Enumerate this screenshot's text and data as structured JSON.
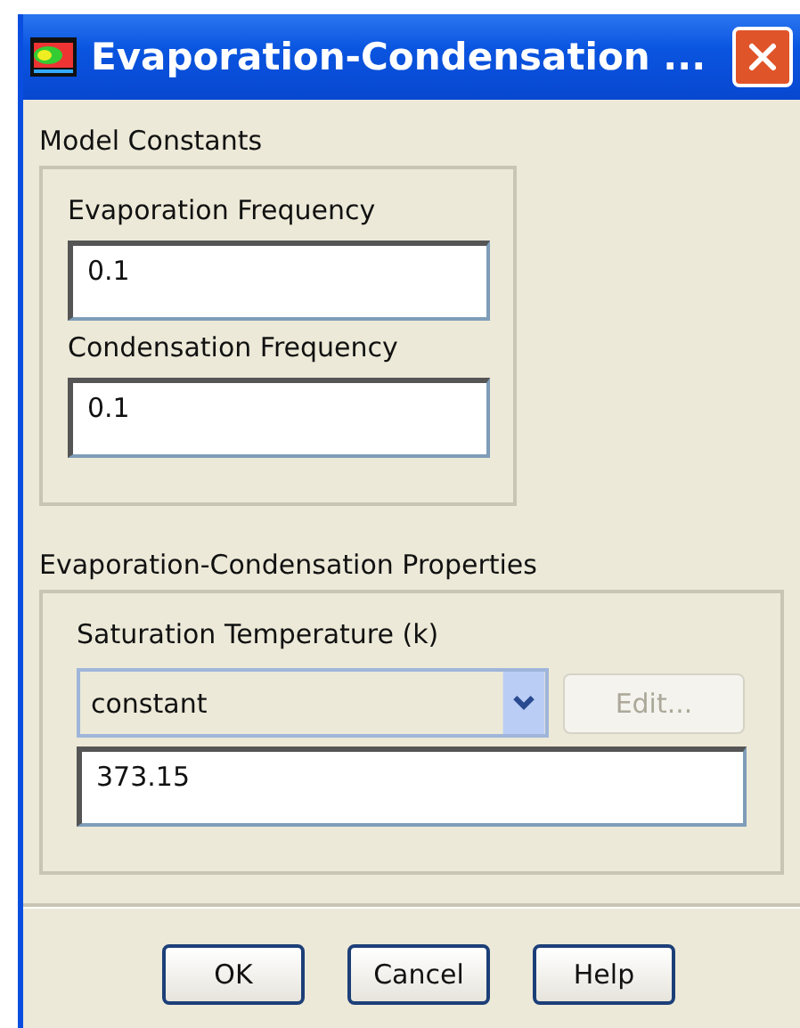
{
  "window": {
    "title": "Evaporation-Condensation ..."
  },
  "model_constants": {
    "title": "Model Constants",
    "fields": [
      {
        "label": "Evaporation Frequency",
        "value": "0.1"
      },
      {
        "label": "Condensation Frequency",
        "value": "0.1"
      }
    ]
  },
  "properties": {
    "title": "Evaporation-Condensation Properties",
    "saturation_temperature": {
      "label": "Saturation Temperature (k)",
      "method": "constant",
      "edit_button": {
        "label": "Edit...",
        "disabled": true
      },
      "value": "373.15"
    }
  },
  "buttons": [
    "OK",
    "Cancel",
    "Help"
  ]
}
